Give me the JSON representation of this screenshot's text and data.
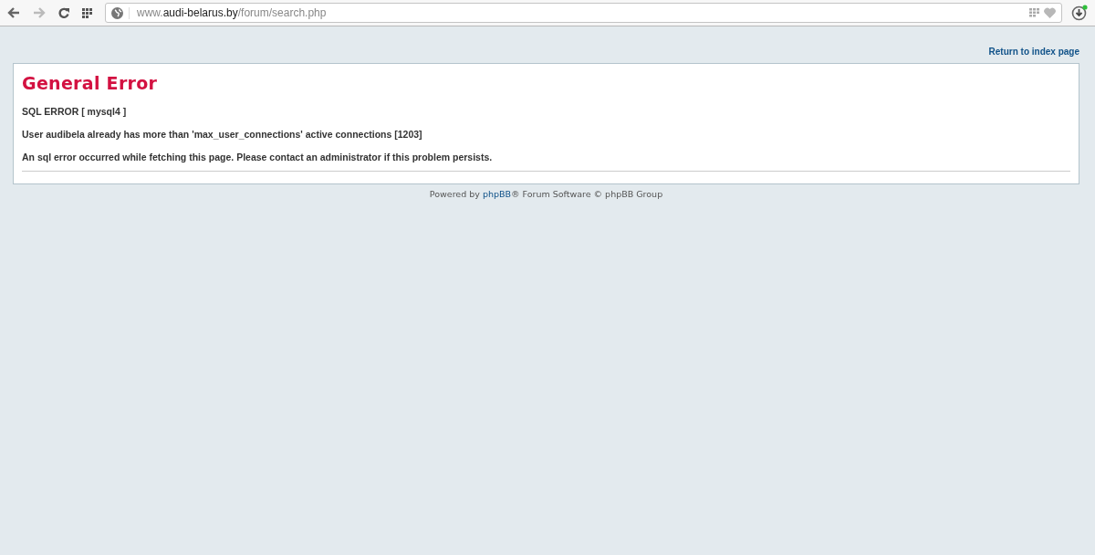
{
  "browser": {
    "address": {
      "prefix": "www.",
      "domain": "audi-belarus.by",
      "path": "/forum/search.php"
    }
  },
  "page": {
    "return_link": "Return to index page",
    "error": {
      "title": "General Error",
      "lines": [
        "SQL ERROR [ mysql4 ]",
        "User audibela already has more than 'max_user_connections' active connections [1203]",
        "An sql error occurred while fetching this page. Please contact an administrator if this problem persists."
      ]
    },
    "footer": {
      "before": "Powered by ",
      "link": "phpBB",
      "after": "® Forum Software © phpBB Group"
    }
  }
}
